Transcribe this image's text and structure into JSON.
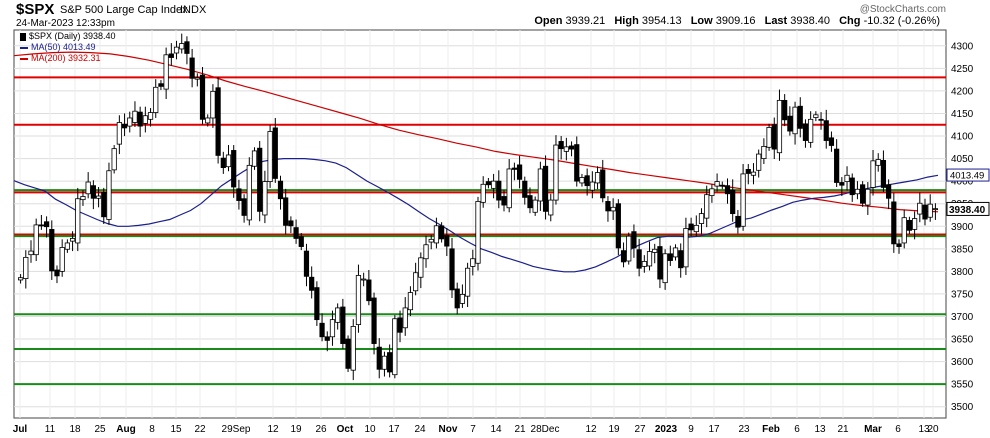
{
  "header": {
    "symbol": "$SPX",
    "description": "S&P 500 Large Cap Index",
    "exchange": "INDX",
    "datetime": "24-Mar-2023 12:33pm",
    "watermark": "@StockCharts.com",
    "open_label": "Open",
    "open": "3939.21",
    "high_label": "High",
    "high": "3954.13",
    "low_label": "Low",
    "low": "3909.16",
    "last_label": "Last",
    "last": "3938.40",
    "chg_label": "Chg",
    "chg": "-10.32 (-0.26%)"
  },
  "legend": [
    {
      "label": "$SPX (Daily) 3938.40",
      "color": "#000000",
      "marker": "candle"
    },
    {
      "label": "MA(50) 4013.49",
      "color": "#1a1f8c",
      "marker": "line"
    },
    {
      "label": "MA(200) 3932.31",
      "color": "#cc0000",
      "marker": "line"
    }
  ],
  "chart_data": {
    "type": "candlestick",
    "y_range": [
      3475,
      4335
    ],
    "y_ticks": [
      3500,
      3550,
      3600,
      3650,
      3700,
      3750,
      3800,
      3850,
      3900,
      3950,
      4000,
      4050,
      4100,
      4150,
      4200,
      4250,
      4300
    ],
    "x_tick_labels": [
      "Jul",
      "11",
      "18",
      "25",
      "Aug",
      "8",
      "15",
      "22",
      "29Sep",
      "12",
      "19",
      "26",
      "Oct",
      "10",
      "17",
      "24",
      "Nov",
      "7",
      "14",
      "21",
      "28Dec",
      "12",
      "19",
      "27",
      "2023",
      "9",
      "17",
      "23",
      "Feb",
      "6",
      "13",
      "21",
      "Mar",
      "6",
      "13",
      "20"
    ],
    "bold_tick_labels": [
      "Jul",
      "Aug",
      "Oct",
      "Nov",
      "2023",
      "Feb",
      "Mar"
    ],
    "price_labels": [
      {
        "text": "4013.49",
        "value": 4013.49,
        "style": "ma50"
      },
      {
        "text": "3938.40",
        "value": 3938.4,
        "style": "last"
      }
    ],
    "horizontal_lines": [
      {
        "value": 4230,
        "color": "#e00000",
        "width": 2
      },
      {
        "value": 4125,
        "color": "#e00000",
        "width": 2
      },
      {
        "value": 3975,
        "color": "#e00000",
        "width": 2
      },
      {
        "value": 3980,
        "color": "#1a8a1a",
        "width": 2
      },
      {
        "value": 3880,
        "color": "#e00000",
        "width": 3.5
      },
      {
        "value": 3878,
        "color": "#1a8a1a",
        "width": 2
      },
      {
        "value": 3705,
        "color": "#1a8a1a",
        "width": 2
      },
      {
        "value": 3628,
        "color": "#1a8a1a",
        "width": 2
      },
      {
        "value": 3550,
        "color": "#1a8a1a",
        "width": 2
      }
    ],
    "series": [
      {
        "name": "$SPX",
        "kind": "close",
        "values": [
          3786,
          3831,
          3845,
          3903,
          3902,
          3899,
          3801,
          3790,
          3853,
          3863,
          3873,
          3961,
          3966,
          3998,
          3962,
          3967,
          3921,
          4023,
          4072,
          4130,
          4118,
          4140,
          4155,
          4122,
          4145,
          4152,
          4208,
          4210,
          4280,
          4274,
          4297,
          4305,
          4283,
          4228,
          4229,
          4137,
          4140,
          4199,
          4057,
          4030,
          4058,
          3987,
          3957,
          3924,
          4035,
          4067,
          3933,
          3999,
          4110,
          4006,
          3961,
          3902,
          3901,
          3873,
          3855,
          3789,
          3758,
          3693,
          3655,
          3647,
          3693,
          3719,
          3640,
          3585,
          3678,
          3791,
          3783,
          3735,
          3640,
          3583,
          3612,
          3577,
          3695,
          3665,
          3719,
          3753,
          3797,
          3830,
          3859,
          3871,
          3901,
          3872,
          3856,
          3759,
          3719,
          3749,
          3807,
          3828,
          3955,
          3993,
          3992,
          4000,
          3958,
          3947,
          4027,
          4026,
          4004,
          3964,
          3941,
          3958,
          4027,
          3933,
          3958,
          4080,
          4072,
          4076,
          4071,
          4000,
          4008,
          3990,
          3998,
          4019,
          3963,
          3934,
          3942,
          3852,
          3821,
          3878,
          3852,
          3807,
          3822,
          3844,
          3849,
          3783,
          3839,
          3824,
          3852,
          3808,
          3895,
          3892,
          3902,
          3928,
          3970,
          3983,
          3999,
          3990,
          3972,
          3928,
          3898,
          4016,
          4017,
          4020,
          4060,
          4077,
          4119,
          4071,
          4179,
          4136,
          4111,
          4164,
          4117,
          4090,
          4137,
          4147,
          4136,
          4090,
          4079,
          3997,
          3991,
          4013,
          3970,
          3982,
          3951,
          3982,
          4045,
          4048,
          3986,
          3962,
          3861,
          3855,
          3919,
          3891,
          3917,
          3951,
          3916,
          3949,
          3938
        ]
      },
      {
        "name": "MA(50)",
        "kind": "ma",
        "values": [
          4001,
          3992,
          3985,
          3978,
          3960,
          3948,
          3935,
          3925,
          3915,
          3906,
          3900,
          3900,
          3902,
          3905,
          3910,
          3915,
          3925,
          3935,
          3950,
          3970,
          3990,
          4005,
          4020,
          4034,
          4044,
          4048,
          4050,
          4050,
          4050,
          4048,
          4045,
          4040,
          4030,
          4015,
          4000,
          3988,
          3975,
          3962,
          3948,
          3932,
          3917,
          3904,
          3890,
          3875,
          3862,
          3850,
          3842,
          3833,
          3826,
          3819,
          3811,
          3806,
          3802,
          3799,
          3799,
          3803,
          3810,
          3820,
          3831,
          3844,
          3856,
          3866,
          3875,
          3878,
          3878,
          3876,
          3878,
          3884,
          3894,
          3904,
          3914,
          3918,
          3927,
          3936,
          3944,
          3953,
          3958,
          3962,
          3964,
          3967,
          3972,
          3978,
          3983,
          3987,
          3991,
          3995,
          3999,
          4003,
          4009,
          4013
        ]
      },
      {
        "name": "MA(200)",
        "kind": "ma",
        "values": [
          4278,
          4282,
          4285,
          4286,
          4285,
          4282,
          4276,
          4268,
          4258,
          4248,
          4236,
          4222,
          4210,
          4199,
          4187,
          4175,
          4163,
          4151,
          4139,
          4125,
          4113,
          4103,
          4094,
          4084,
          4076,
          4066,
          4059,
          4053,
          4047,
          4040,
          4033,
          4026,
          4019,
          4013,
          4007,
          4001,
          3995,
          3988,
          3982,
          3976,
          3970,
          3964,
          3958,
          3951,
          3946,
          3942,
          3937,
          3934,
          3932
        ]
      }
    ]
  }
}
